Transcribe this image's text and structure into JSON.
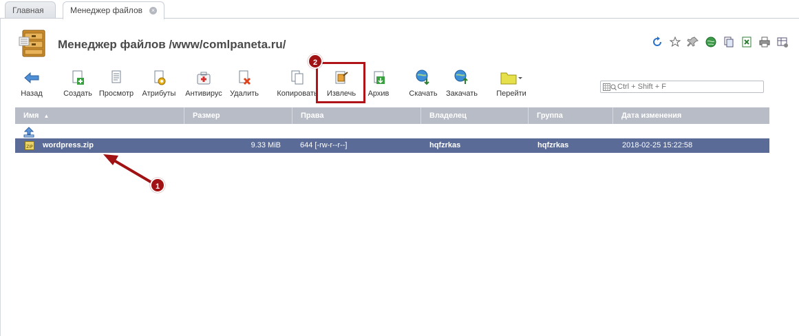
{
  "tabs": [
    {
      "label": "Главная",
      "active": false
    },
    {
      "label": "Менеджер файлов",
      "active": true
    }
  ],
  "header": {
    "title": "Менеджер файлов /www/comlpaneta.ru/",
    "top_icons": [
      "refresh-icon",
      "star-icon",
      "pin-icon",
      "globe-icon",
      "copy-icon",
      "excel-icon",
      "print-icon",
      "settings-table-icon"
    ]
  },
  "toolbar": {
    "back": "Назад",
    "create": "Создать",
    "view": "Просмотр",
    "attributes": "Атрибуты",
    "antivirus": "Антивирус",
    "delete": "Удалить",
    "copy": "Копировать",
    "extract": "Извлечь",
    "archive": "Архив",
    "download": "Скачать",
    "upload": "Закачать",
    "goto": "Перейти"
  },
  "search": {
    "placeholder": "Ctrl + Shift + F"
  },
  "table": {
    "columns": [
      "Имя",
      "Размер",
      "Права",
      "Владелец",
      "Группа",
      "Дата изменения"
    ],
    "sort_indicator": "▲",
    "rows": [
      {
        "name": "wordpress.zip",
        "size": "9.33 MiB",
        "permissions": "644 [-rw-r--r--]",
        "owner": "hqfzrkas",
        "group": "hqfzrkas",
        "modified": "2018-02-25 15:22:58",
        "selected": true
      }
    ]
  },
  "annotations": {
    "marker1": "1",
    "marker2": "2"
  },
  "colors": {
    "header_bg": "#b8bcc6",
    "selected_row": "#5a6b97",
    "annotation_red": "#a01214"
  }
}
